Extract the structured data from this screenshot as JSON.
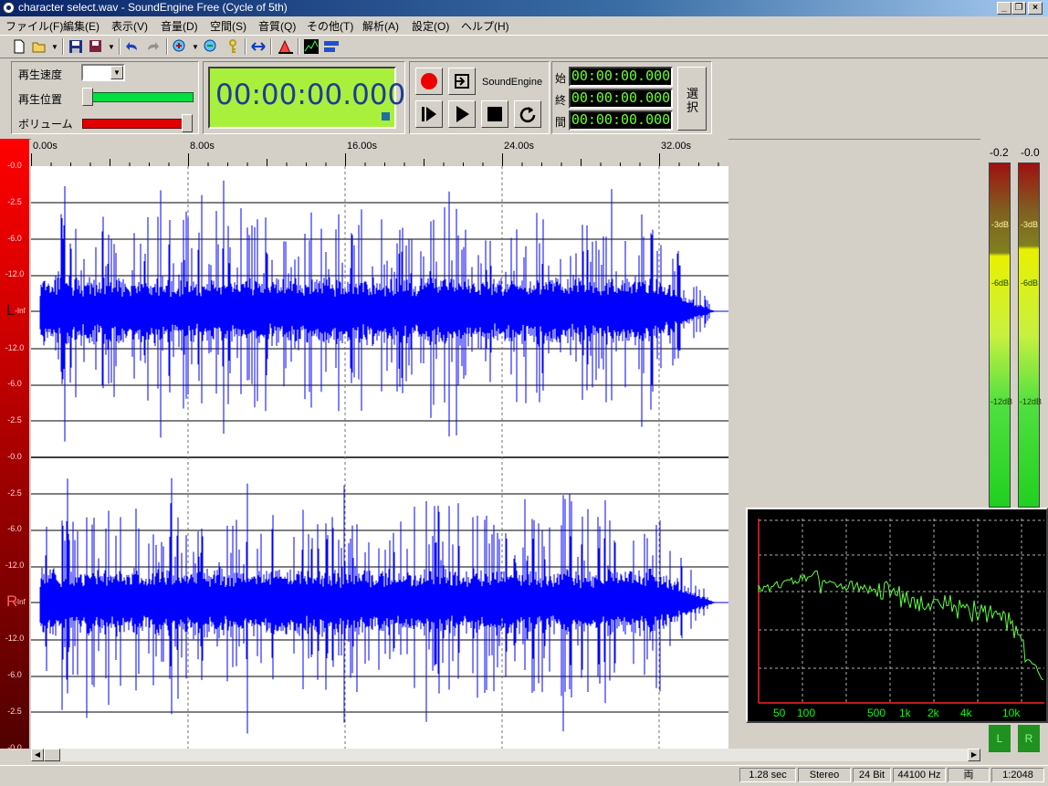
{
  "window": {
    "title": "character select.wav - SoundEngine Free (Cycle of 5th)"
  },
  "menu": [
    "ファイル(F)",
    "編集(E)",
    "表示(V)",
    "音量(D)",
    "空間(S)",
    "音質(Q)",
    "その他(T)",
    "解析(A)",
    "設定(O)",
    "ヘルプ(H)"
  ],
  "controls": {
    "speed_label": "再生速度",
    "position_label": "再生位置",
    "volume_label": "ボリューム",
    "main_time": "00:00:00.000",
    "engine_label": "SoundEngine",
    "start_label": "始",
    "end_label": "終",
    "length_label": "間",
    "start_time": "00:00:00.000",
    "end_time": "00:00:00.000",
    "length_time": "00:00:00.000",
    "select_label": "選択"
  },
  "ruler": [
    "0.00s",
    "8.00s",
    "16.00s",
    "24.00s",
    "32.00s"
  ],
  "db_scale": {
    "left": [
      "-0.0",
      "-2.5",
      "-6.0",
      "-12.0",
      "-Inf",
      "-12.0",
      "-6.0",
      "-2.5",
      "-0.0"
    ],
    "right": [
      "-2.5",
      "-6.0",
      "-12.0",
      "-Inf",
      "-12.0",
      "-6.0",
      "-2.5",
      "-0.0"
    ],
    "channel_left": "L",
    "channel_right": "R"
  },
  "meters": {
    "left_peak": "-0.2",
    "right_peak": "-0.0",
    "marks": [
      "-3dB",
      "-6dB",
      "-12dB"
    ],
    "left_btn": "L",
    "right_btn": "R"
  },
  "spectrum": {
    "labels": [
      "50",
      "100",
      "500",
      "1k",
      "2k",
      "4k",
      "10k"
    ]
  },
  "status": [
    "1.28 sec",
    "Stereo",
    "24 Bit",
    "44100 Hz",
    "両",
    "1:2048"
  ],
  "colors": {
    "wave": "#0000ff",
    "lcd": "#a8f03c",
    "meter_green": "#20d020",
    "spectrum_line": "#60ff40"
  }
}
